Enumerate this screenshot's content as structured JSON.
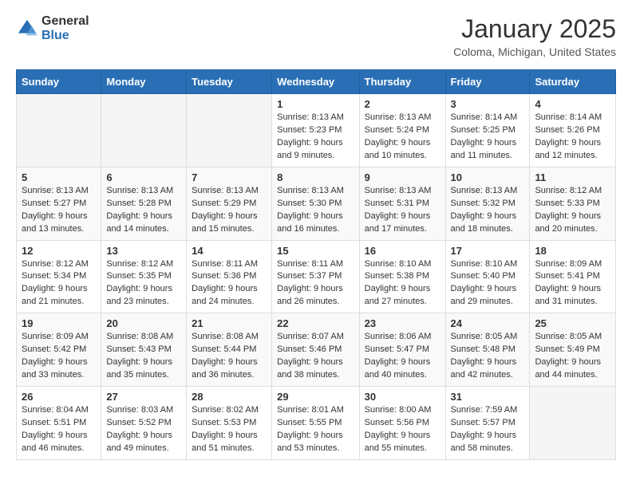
{
  "logo": {
    "general": "General",
    "blue": "Blue"
  },
  "header": {
    "title": "January 2025",
    "subtitle": "Coloma, Michigan, United States"
  },
  "weekdays": [
    "Sunday",
    "Monday",
    "Tuesday",
    "Wednesday",
    "Thursday",
    "Friday",
    "Saturday"
  ],
  "weeks": [
    [
      {
        "day": "",
        "info": ""
      },
      {
        "day": "",
        "info": ""
      },
      {
        "day": "",
        "info": ""
      },
      {
        "day": "1",
        "info": "Sunrise: 8:13 AM\nSunset: 5:23 PM\nDaylight: 9 hours and 9 minutes."
      },
      {
        "day": "2",
        "info": "Sunrise: 8:13 AM\nSunset: 5:24 PM\nDaylight: 9 hours and 10 minutes."
      },
      {
        "day": "3",
        "info": "Sunrise: 8:14 AM\nSunset: 5:25 PM\nDaylight: 9 hours and 11 minutes."
      },
      {
        "day": "4",
        "info": "Sunrise: 8:14 AM\nSunset: 5:26 PM\nDaylight: 9 hours and 12 minutes."
      }
    ],
    [
      {
        "day": "5",
        "info": "Sunrise: 8:13 AM\nSunset: 5:27 PM\nDaylight: 9 hours and 13 minutes."
      },
      {
        "day": "6",
        "info": "Sunrise: 8:13 AM\nSunset: 5:28 PM\nDaylight: 9 hours and 14 minutes."
      },
      {
        "day": "7",
        "info": "Sunrise: 8:13 AM\nSunset: 5:29 PM\nDaylight: 9 hours and 15 minutes."
      },
      {
        "day": "8",
        "info": "Sunrise: 8:13 AM\nSunset: 5:30 PM\nDaylight: 9 hours and 16 minutes."
      },
      {
        "day": "9",
        "info": "Sunrise: 8:13 AM\nSunset: 5:31 PM\nDaylight: 9 hours and 17 minutes."
      },
      {
        "day": "10",
        "info": "Sunrise: 8:13 AM\nSunset: 5:32 PM\nDaylight: 9 hours and 18 minutes."
      },
      {
        "day": "11",
        "info": "Sunrise: 8:12 AM\nSunset: 5:33 PM\nDaylight: 9 hours and 20 minutes."
      }
    ],
    [
      {
        "day": "12",
        "info": "Sunrise: 8:12 AM\nSunset: 5:34 PM\nDaylight: 9 hours and 21 minutes."
      },
      {
        "day": "13",
        "info": "Sunrise: 8:12 AM\nSunset: 5:35 PM\nDaylight: 9 hours and 23 minutes."
      },
      {
        "day": "14",
        "info": "Sunrise: 8:11 AM\nSunset: 5:36 PM\nDaylight: 9 hours and 24 minutes."
      },
      {
        "day": "15",
        "info": "Sunrise: 8:11 AM\nSunset: 5:37 PM\nDaylight: 9 hours and 26 minutes."
      },
      {
        "day": "16",
        "info": "Sunrise: 8:10 AM\nSunset: 5:38 PM\nDaylight: 9 hours and 27 minutes."
      },
      {
        "day": "17",
        "info": "Sunrise: 8:10 AM\nSunset: 5:40 PM\nDaylight: 9 hours and 29 minutes."
      },
      {
        "day": "18",
        "info": "Sunrise: 8:09 AM\nSunset: 5:41 PM\nDaylight: 9 hours and 31 minutes."
      }
    ],
    [
      {
        "day": "19",
        "info": "Sunrise: 8:09 AM\nSunset: 5:42 PM\nDaylight: 9 hours and 33 minutes."
      },
      {
        "day": "20",
        "info": "Sunrise: 8:08 AM\nSunset: 5:43 PM\nDaylight: 9 hours and 35 minutes."
      },
      {
        "day": "21",
        "info": "Sunrise: 8:08 AM\nSunset: 5:44 PM\nDaylight: 9 hours and 36 minutes."
      },
      {
        "day": "22",
        "info": "Sunrise: 8:07 AM\nSunset: 5:46 PM\nDaylight: 9 hours and 38 minutes."
      },
      {
        "day": "23",
        "info": "Sunrise: 8:06 AM\nSunset: 5:47 PM\nDaylight: 9 hours and 40 minutes."
      },
      {
        "day": "24",
        "info": "Sunrise: 8:05 AM\nSunset: 5:48 PM\nDaylight: 9 hours and 42 minutes."
      },
      {
        "day": "25",
        "info": "Sunrise: 8:05 AM\nSunset: 5:49 PM\nDaylight: 9 hours and 44 minutes."
      }
    ],
    [
      {
        "day": "26",
        "info": "Sunrise: 8:04 AM\nSunset: 5:51 PM\nDaylight: 9 hours and 46 minutes."
      },
      {
        "day": "27",
        "info": "Sunrise: 8:03 AM\nSunset: 5:52 PM\nDaylight: 9 hours and 49 minutes."
      },
      {
        "day": "28",
        "info": "Sunrise: 8:02 AM\nSunset: 5:53 PM\nDaylight: 9 hours and 51 minutes."
      },
      {
        "day": "29",
        "info": "Sunrise: 8:01 AM\nSunset: 5:55 PM\nDaylight: 9 hours and 53 minutes."
      },
      {
        "day": "30",
        "info": "Sunrise: 8:00 AM\nSunset: 5:56 PM\nDaylight: 9 hours and 55 minutes."
      },
      {
        "day": "31",
        "info": "Sunrise: 7:59 AM\nSunset: 5:57 PM\nDaylight: 9 hours and 58 minutes."
      },
      {
        "day": "",
        "info": ""
      }
    ]
  ]
}
